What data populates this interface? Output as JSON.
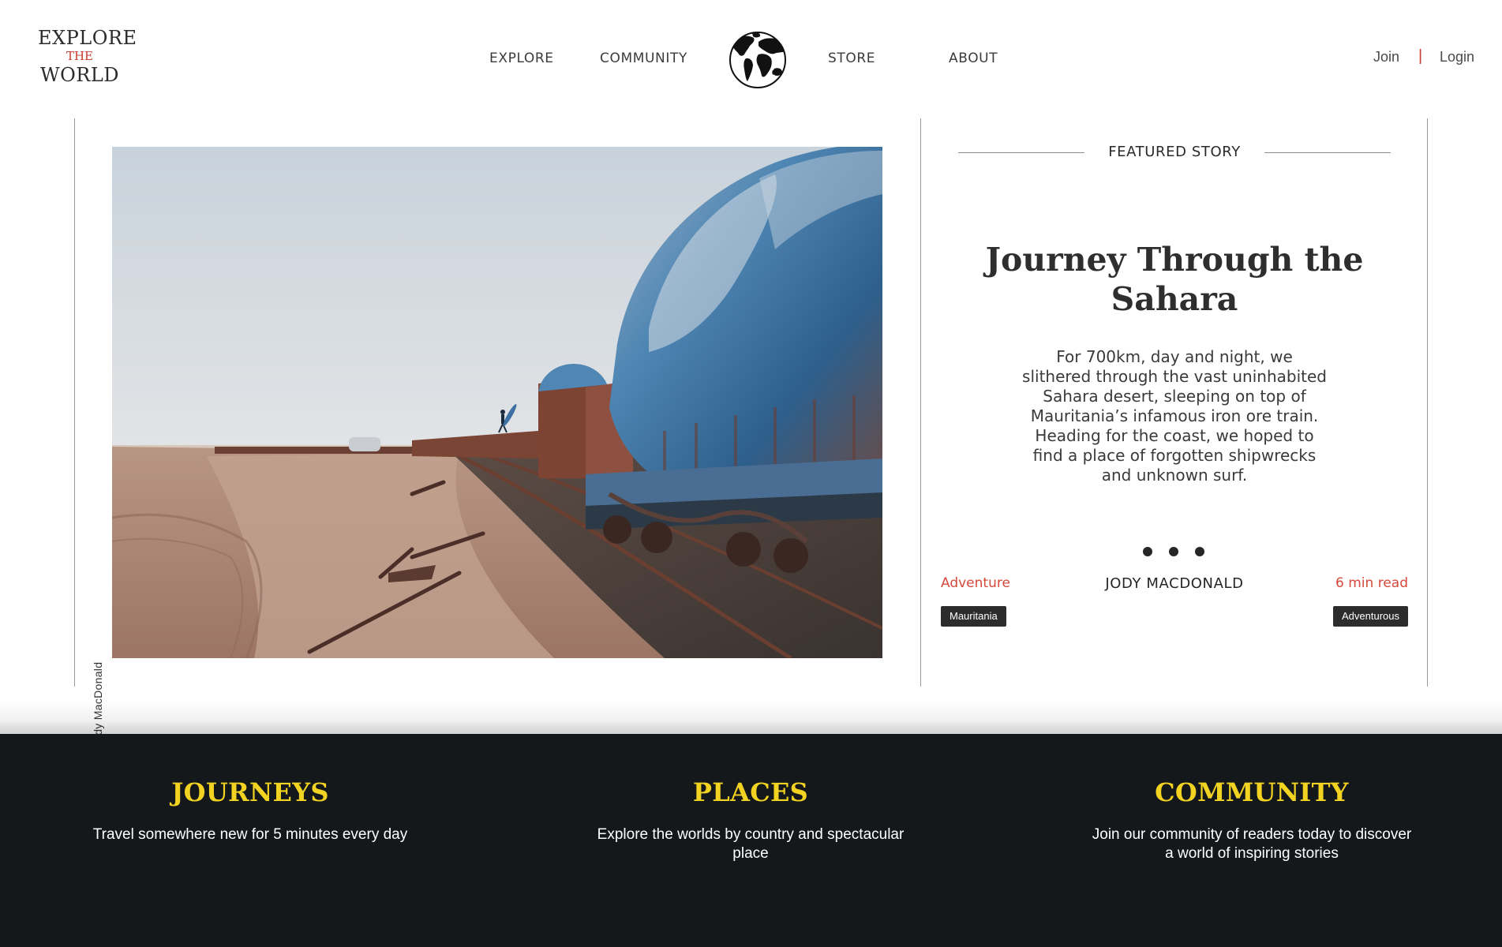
{
  "header": {
    "logo": {
      "line1": "EXPLORE",
      "line2": "THE",
      "line3": "WORLD"
    },
    "nav": {
      "explore": "EXPLORE",
      "community": "COMMUNITY",
      "store": "STORE",
      "about": "ABOUT"
    },
    "globe_icon": "globe-icon",
    "auth": {
      "join": "Join",
      "separator": "|",
      "login": "Login"
    }
  },
  "featured": {
    "photo_credit": "© Jody MacDonald",
    "label": "FEATURED STORY",
    "title": "Journey Through the Sahara",
    "body": "For 700km, day and night, we slithered through the vast uninhabited Sahara desert, sleeping on top of Mauritania’s infamous iron ore train. Heading for the coast, we hoped to find a place of forgotten shipwrecks and unknown surf.",
    "category": "Adventure",
    "author": "JODY MACDONALD",
    "read_time": "6 min read",
    "tags": [
      "Mauritania",
      "Adventurous"
    ],
    "carousel_dots": 3
  },
  "sections": [
    {
      "title": "JOURNEYS",
      "text": "Travel somewhere new for 5 minutes every day"
    },
    {
      "title": "PLACES",
      "text": "Explore the worlds by country and spectacular place"
    },
    {
      "title": "COMMUNITY",
      "text": "Join our community of readers today to discover a world of inspiring stories"
    }
  ],
  "colors": {
    "accent_red": "#d5483a",
    "band_background": "#15181b",
    "band_title_yellow": "#f3d321",
    "tag_background": "#2c2c2c"
  }
}
